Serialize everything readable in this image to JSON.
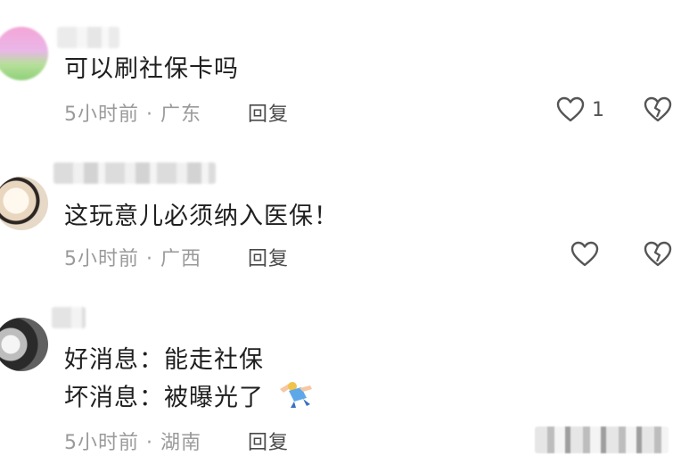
{
  "comments": [
    {
      "text": "可以刷社保卡吗",
      "meta": "5小时前 · 广东",
      "reply_label": "回复",
      "like_count": "1"
    },
    {
      "text": "这玩意儿必须纳入医保！",
      "meta": "5小时前 · 广西",
      "reply_label": "回复",
      "like_count": ""
    },
    {
      "lines": [
        "好消息：能走社保",
        "坏消息：被曝光了"
      ],
      "meta": "5小时前 · 湖南",
      "reply_label": "回复"
    }
  ],
  "icons": {
    "like": "heart-outline-icon",
    "dislike": "broken-heart-icon",
    "emoji": "shrug-emoji-icon"
  },
  "colors": {
    "meta_text": "#9a9a9a",
    "reply_text": "#4a4a4a",
    "icon_stroke": "#555555"
  }
}
